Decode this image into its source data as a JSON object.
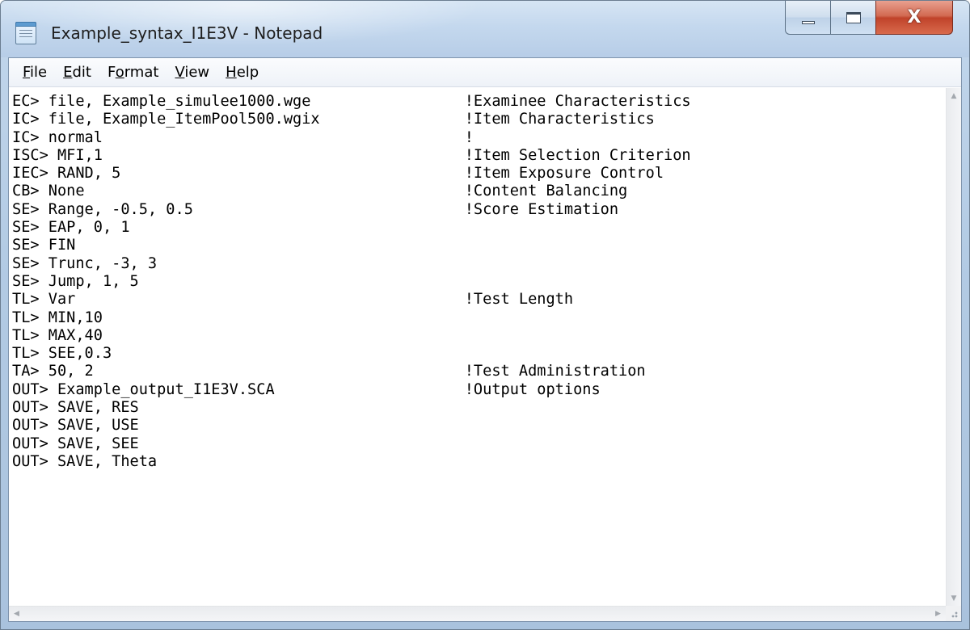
{
  "window": {
    "title": "Example_syntax_I1E3V - Notepad",
    "app_icon": "notepad-icon",
    "caption_buttons": {
      "minimize_icon": "minimize-icon",
      "maximize_icon": "maximize-icon",
      "close_icon": "close-icon",
      "close_glyph": "X"
    }
  },
  "menubar": {
    "items": [
      {
        "accel": "F",
        "rest": "ile"
      },
      {
        "accel": "E",
        "rest": "dit"
      },
      {
        "pre": "F",
        "accel": "o",
        "rest": "rmat"
      },
      {
        "accel": "V",
        "rest": "iew"
      },
      {
        "accel": "H",
        "rest": "elp"
      }
    ]
  },
  "editor": {
    "lines": [
      {
        "code": "EC> file, Example_simulee1000.wge",
        "comment": "!Examinee Characteristics"
      },
      {
        "code": "IC> file, Example_ItemPool500.wgix",
        "comment": "!Item Characteristics"
      },
      {
        "code": "IC> normal",
        "comment": "!"
      },
      {
        "code": "ISC> MFI,1",
        "comment": "!Item Selection Criterion"
      },
      {
        "code": "IEC> RAND, 5",
        "comment": "!Item Exposure Control"
      },
      {
        "code": "CB> None",
        "comment": "!Content Balancing"
      },
      {
        "code": "SE> Range, -0.5, 0.5",
        "comment": "!Score Estimation"
      },
      {
        "code": "SE> EAP, 0, 1",
        "comment": ""
      },
      {
        "code": "SE> FIN",
        "comment": ""
      },
      {
        "code": "SE> Trunc, -3, 3",
        "comment": ""
      },
      {
        "code": "SE> Jump, 1, 5",
        "comment": ""
      },
      {
        "code": "TL> Var",
        "comment": "!Test Length"
      },
      {
        "code": "TL> MIN,10",
        "comment": ""
      },
      {
        "code": "TL> MAX,40",
        "comment": ""
      },
      {
        "code": "TL> SEE,0.3",
        "comment": ""
      },
      {
        "code": "TA> 50, 2",
        "comment": "!Test Administration"
      },
      {
        "code": "OUT> Example_output_I1E3V.SCA",
        "comment": "!Output options"
      },
      {
        "code": "OUT> SAVE, RES",
        "comment": ""
      },
      {
        "code": "OUT> SAVE, USE",
        "comment": ""
      },
      {
        "code": "OUT> SAVE, SEE",
        "comment": ""
      },
      {
        "code": "OUT> SAVE, Theta",
        "comment": ""
      }
    ]
  },
  "scrollbars": {
    "up_arrow": "▲",
    "down_arrow": "▼",
    "left_arrow": "◀",
    "right_arrow": "▶"
  }
}
